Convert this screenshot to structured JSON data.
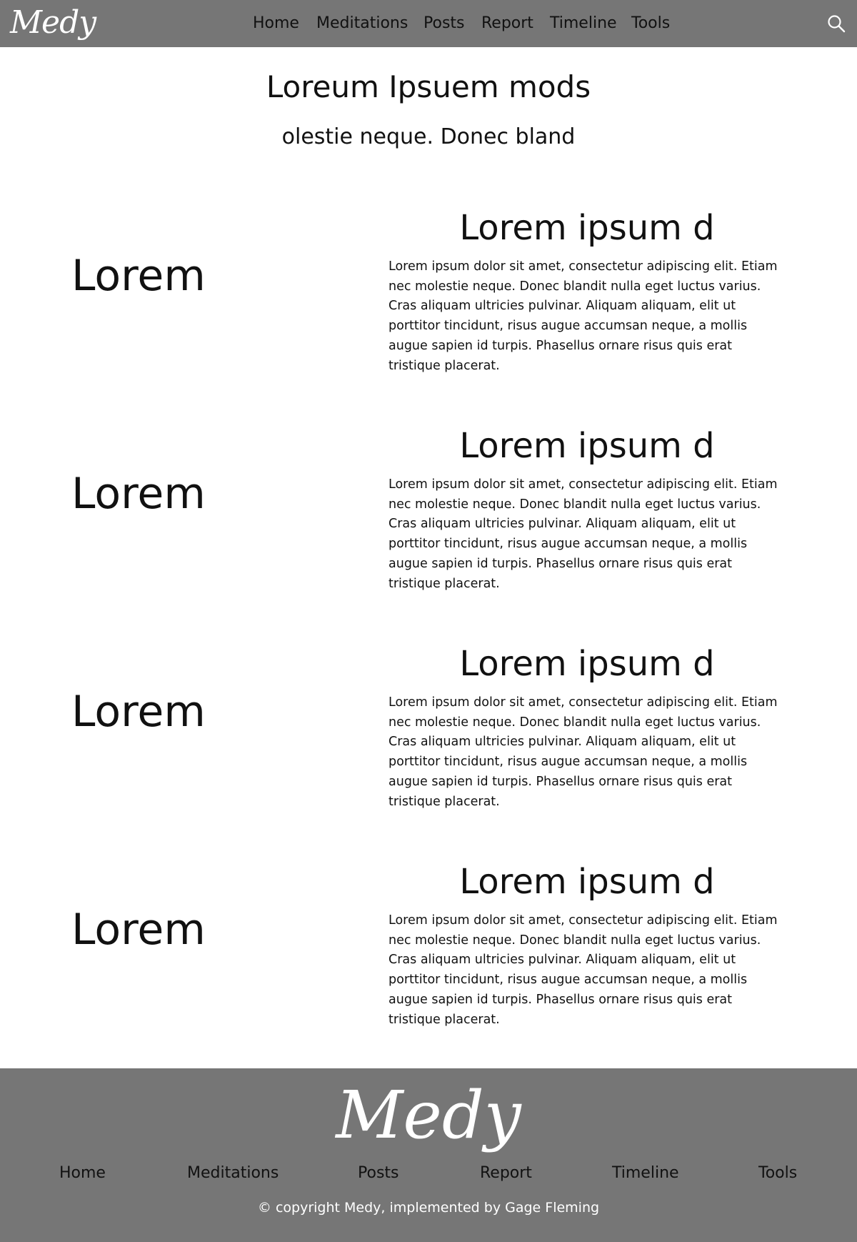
{
  "header": {
    "logo": "Medy",
    "nav": [
      "Home",
      "Meditations",
      "Posts",
      "Report",
      "Timeline",
      "Tools"
    ],
    "search_icon": "search-icon"
  },
  "hero": {
    "title": "Loreum Ipsuem mods",
    "subtitle": "olestie neque. Donec bland"
  },
  "rows": [
    {
      "left": "Lorem",
      "heading": "Lorem ipsum d",
      "body": "Lorem ipsum dolor sit amet, consectetur adipiscing elit. Etiam nec molestie neque. Donec blandit nulla eget luctus varius. Cras aliquam ultricies pulvinar. Aliquam aliquam, elit ut porttitor tincidunt, risus augue accumsan neque, a mollis augue sapien id turpis. Phasellus ornare risus quis erat tristique placerat."
    },
    {
      "left": "Lorem",
      "heading": "Lorem ipsum d",
      "body": "Lorem ipsum dolor sit amet, consectetur adipiscing elit. Etiam nec molestie neque. Donec blandit nulla eget luctus varius. Cras aliquam ultricies pulvinar. Aliquam aliquam, elit ut porttitor tincidunt, risus augue accumsan neque, a mollis augue sapien id turpis. Phasellus ornare risus quis erat tristique placerat."
    },
    {
      "left": "Lorem",
      "heading": "Lorem ipsum d",
      "body": "Lorem ipsum dolor sit amet, consectetur adipiscing elit. Etiam nec molestie neque. Donec blandit nulla eget luctus varius. Cras aliquam ultricies pulvinar. Aliquam aliquam, elit ut porttitor tincidunt, risus augue accumsan neque, a mollis augue sapien id turpis. Phasellus ornare risus quis erat tristique placerat."
    },
    {
      "left": "Lorem",
      "heading": "Lorem ipsum d",
      "body": "Lorem ipsum dolor sit amet, consectetur adipiscing elit. Etiam nec molestie neque. Donec blandit nulla eget luctus varius. Cras aliquam ultricies pulvinar. Aliquam aliquam, elit ut porttitor tincidunt, risus augue accumsan neque, a mollis augue sapien id turpis. Phasellus ornare risus quis erat tristique placerat."
    }
  ],
  "footer": {
    "logo": "Medy",
    "nav": [
      "Home",
      "Meditations",
      "Posts",
      "Report",
      "Timeline",
      "Tools"
    ],
    "copyright": "© copyright Medy, implemented by Gage Fleming"
  },
  "colors": {
    "bar_background": "#767676",
    "page_background": "#ffffff",
    "text": "#111111",
    "logo": "#ffffff"
  }
}
